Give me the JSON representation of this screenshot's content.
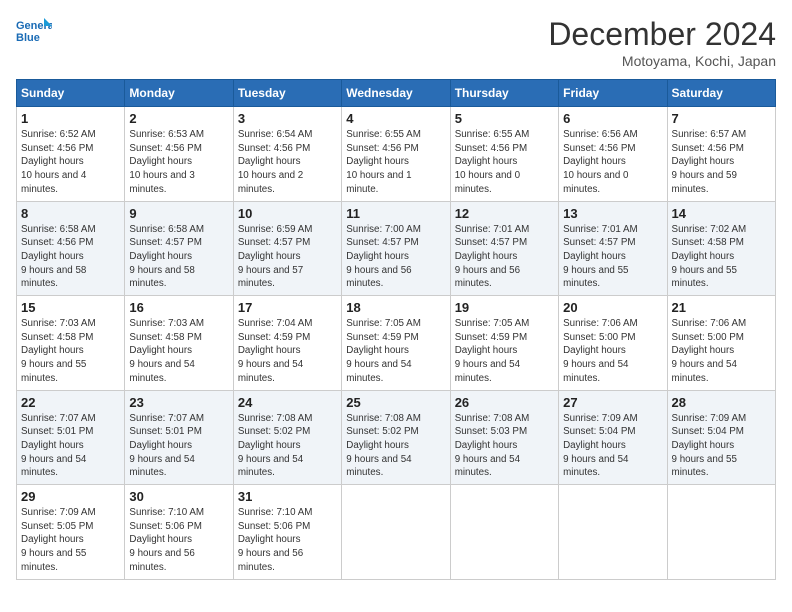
{
  "header": {
    "logo_line1": "General",
    "logo_line2": "Blue",
    "month": "December 2024",
    "location": "Motoyama, Kochi, Japan"
  },
  "weekdays": [
    "Sunday",
    "Monday",
    "Tuesday",
    "Wednesday",
    "Thursday",
    "Friday",
    "Saturday"
  ],
  "weeks": [
    [
      {
        "day": "1",
        "sunrise": "6:52 AM",
        "sunset": "4:56 PM",
        "daylight": "10 hours and 4 minutes."
      },
      {
        "day": "2",
        "sunrise": "6:53 AM",
        "sunset": "4:56 PM",
        "daylight": "10 hours and 3 minutes."
      },
      {
        "day": "3",
        "sunrise": "6:54 AM",
        "sunset": "4:56 PM",
        "daylight": "10 hours and 2 minutes."
      },
      {
        "day": "4",
        "sunrise": "6:55 AM",
        "sunset": "4:56 PM",
        "daylight": "10 hours and 1 minute."
      },
      {
        "day": "5",
        "sunrise": "6:55 AM",
        "sunset": "4:56 PM",
        "daylight": "10 hours and 0 minutes."
      },
      {
        "day": "6",
        "sunrise": "6:56 AM",
        "sunset": "4:56 PM",
        "daylight": "10 hours and 0 minutes."
      },
      {
        "day": "7",
        "sunrise": "6:57 AM",
        "sunset": "4:56 PM",
        "daylight": "9 hours and 59 minutes."
      }
    ],
    [
      {
        "day": "8",
        "sunrise": "6:58 AM",
        "sunset": "4:56 PM",
        "daylight": "9 hours and 58 minutes."
      },
      {
        "day": "9",
        "sunrise": "6:58 AM",
        "sunset": "4:57 PM",
        "daylight": "9 hours and 58 minutes."
      },
      {
        "day": "10",
        "sunrise": "6:59 AM",
        "sunset": "4:57 PM",
        "daylight": "9 hours and 57 minutes."
      },
      {
        "day": "11",
        "sunrise": "7:00 AM",
        "sunset": "4:57 PM",
        "daylight": "9 hours and 56 minutes."
      },
      {
        "day": "12",
        "sunrise": "7:01 AM",
        "sunset": "4:57 PM",
        "daylight": "9 hours and 56 minutes."
      },
      {
        "day": "13",
        "sunrise": "7:01 AM",
        "sunset": "4:57 PM",
        "daylight": "9 hours and 55 minutes."
      },
      {
        "day": "14",
        "sunrise": "7:02 AM",
        "sunset": "4:58 PM",
        "daylight": "9 hours and 55 minutes."
      }
    ],
    [
      {
        "day": "15",
        "sunrise": "7:03 AM",
        "sunset": "4:58 PM",
        "daylight": "9 hours and 55 minutes."
      },
      {
        "day": "16",
        "sunrise": "7:03 AM",
        "sunset": "4:58 PM",
        "daylight": "9 hours and 54 minutes."
      },
      {
        "day": "17",
        "sunrise": "7:04 AM",
        "sunset": "4:59 PM",
        "daylight": "9 hours and 54 minutes."
      },
      {
        "day": "18",
        "sunrise": "7:05 AM",
        "sunset": "4:59 PM",
        "daylight": "9 hours and 54 minutes."
      },
      {
        "day": "19",
        "sunrise": "7:05 AM",
        "sunset": "4:59 PM",
        "daylight": "9 hours and 54 minutes."
      },
      {
        "day": "20",
        "sunrise": "7:06 AM",
        "sunset": "5:00 PM",
        "daylight": "9 hours and 54 minutes."
      },
      {
        "day": "21",
        "sunrise": "7:06 AM",
        "sunset": "5:00 PM",
        "daylight": "9 hours and 54 minutes."
      }
    ],
    [
      {
        "day": "22",
        "sunrise": "7:07 AM",
        "sunset": "5:01 PM",
        "daylight": "9 hours and 54 minutes."
      },
      {
        "day": "23",
        "sunrise": "7:07 AM",
        "sunset": "5:01 PM",
        "daylight": "9 hours and 54 minutes."
      },
      {
        "day": "24",
        "sunrise": "7:08 AM",
        "sunset": "5:02 PM",
        "daylight": "9 hours and 54 minutes."
      },
      {
        "day": "25",
        "sunrise": "7:08 AM",
        "sunset": "5:02 PM",
        "daylight": "9 hours and 54 minutes."
      },
      {
        "day": "26",
        "sunrise": "7:08 AM",
        "sunset": "5:03 PM",
        "daylight": "9 hours and 54 minutes."
      },
      {
        "day": "27",
        "sunrise": "7:09 AM",
        "sunset": "5:04 PM",
        "daylight": "9 hours and 54 minutes."
      },
      {
        "day": "28",
        "sunrise": "7:09 AM",
        "sunset": "5:04 PM",
        "daylight": "9 hours and 55 minutes."
      }
    ],
    [
      {
        "day": "29",
        "sunrise": "7:09 AM",
        "sunset": "5:05 PM",
        "daylight": "9 hours and 55 minutes."
      },
      {
        "day": "30",
        "sunrise": "7:10 AM",
        "sunset": "5:06 PM",
        "daylight": "9 hours and 56 minutes."
      },
      {
        "day": "31",
        "sunrise": "7:10 AM",
        "sunset": "5:06 PM",
        "daylight": "9 hours and 56 minutes."
      },
      null,
      null,
      null,
      null
    ]
  ]
}
